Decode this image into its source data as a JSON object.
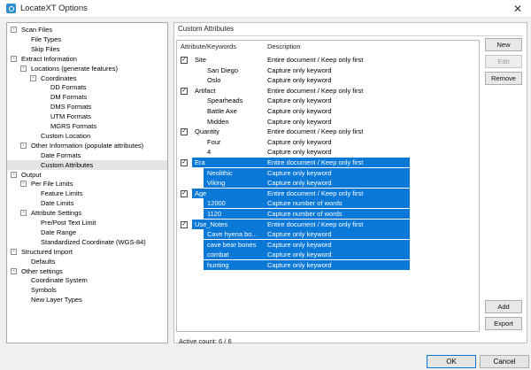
{
  "window": {
    "title": "LocateXT Options",
    "close_glyph": "✕"
  },
  "tree": {
    "items": [
      {
        "label": "Scan Files",
        "level": 0,
        "expander": "-"
      },
      {
        "label": "File Types",
        "level": 1,
        "expander": ""
      },
      {
        "label": "Skip Files",
        "level": 1,
        "expander": ""
      },
      {
        "label": "Extract Information",
        "level": 0,
        "expander": "-"
      },
      {
        "label": "Locations (generate features)",
        "level": 1,
        "expander": "-"
      },
      {
        "label": "Coordinates",
        "level": 2,
        "expander": "-"
      },
      {
        "label": "DD Formats",
        "level": 3,
        "expander": ""
      },
      {
        "label": "DM Formats",
        "level": 3,
        "expander": ""
      },
      {
        "label": "DMS Formats",
        "level": 3,
        "expander": ""
      },
      {
        "label": "UTM Formats",
        "level": 3,
        "expander": ""
      },
      {
        "label": "MGRS Formats",
        "level": 3,
        "expander": ""
      },
      {
        "label": "Custom Location",
        "level": 2,
        "expander": ""
      },
      {
        "label": "Other Information (populate attributes)",
        "level": 1,
        "expander": "-"
      },
      {
        "label": "Date Formats",
        "level": 2,
        "expander": ""
      },
      {
        "label": "Custom Attributes",
        "level": 2,
        "expander": "",
        "selected": true
      },
      {
        "label": "Output",
        "level": 0,
        "expander": "-"
      },
      {
        "label": "Per File Limits",
        "level": 1,
        "expander": "-"
      },
      {
        "label": "Feature Limits",
        "level": 2,
        "expander": ""
      },
      {
        "label": "Date Limits",
        "level": 2,
        "expander": ""
      },
      {
        "label": "Attribute Settings",
        "level": 1,
        "expander": "-"
      },
      {
        "label": "Pre/Post Text Limit",
        "level": 2,
        "expander": ""
      },
      {
        "label": "Date Range",
        "level": 2,
        "expander": ""
      },
      {
        "label": "Standardized Coordinate (WGS-84)",
        "level": 2,
        "expander": ""
      },
      {
        "label": "Structured Import",
        "level": 0,
        "expander": "-"
      },
      {
        "label": "Defaults",
        "level": 1,
        "expander": ""
      },
      {
        "label": "Other settings",
        "level": 0,
        "expander": "-"
      },
      {
        "label": "Coordinate System",
        "level": 1,
        "expander": ""
      },
      {
        "label": "Symbols",
        "level": 1,
        "expander": ""
      },
      {
        "label": "New Layer Types",
        "level": 1,
        "expander": ""
      }
    ]
  },
  "panel": {
    "title": "Custom Attributes",
    "columns": {
      "keywords": "Attribute/Keywords",
      "description": "Description"
    },
    "rows": [
      {
        "kw": "Site",
        "desc": "Entire document / Keep only first",
        "parent": true,
        "checked": true,
        "selected": false
      },
      {
        "kw": "San Diego",
        "desc": "Capture only keyword",
        "parent": false,
        "selected": false
      },
      {
        "kw": "Oslo",
        "desc": "Capture only keyword",
        "parent": false,
        "selected": false
      },
      {
        "kw": "Artifact",
        "desc": "Entire document / Keep only first",
        "parent": true,
        "checked": true,
        "selected": false
      },
      {
        "kw": "Spearheads",
        "desc": "Capture only keyword",
        "parent": false,
        "selected": false
      },
      {
        "kw": "Battle Axe",
        "desc": "Capture only keyword",
        "parent": false,
        "selected": false
      },
      {
        "kw": "Midden",
        "desc": "Capture only keyword",
        "parent": false,
        "selected": false
      },
      {
        "kw": "Quantity",
        "desc": "Entire document / Keep only first",
        "parent": true,
        "checked": true,
        "selected": false
      },
      {
        "kw": "Four",
        "desc": "Capture only keyword",
        "parent": false,
        "selected": false
      },
      {
        "kw": "4",
        "desc": "Capture only keyword",
        "parent": false,
        "selected": false
      },
      {
        "kw": "Era",
        "desc": "Entire document / Keep only first",
        "parent": true,
        "checked": true,
        "selected": true
      },
      {
        "kw": "Neolithic",
        "desc": "Capture only keyword",
        "parent": false,
        "selected": true
      },
      {
        "kw": "Viking",
        "desc": "Capture only keyword",
        "parent": false,
        "selected": true
      },
      {
        "kw": "Age",
        "desc": "Entire document / Keep only first",
        "parent": true,
        "checked": true,
        "selected": true
      },
      {
        "kw": "12000",
        "desc": "Capture number of words",
        "parent": false,
        "selected": true
      },
      {
        "kw": "1120",
        "desc": "Capture number of words",
        "parent": false,
        "selected": true
      },
      {
        "kw": "Use_Notes",
        "desc": "Entire document / Keep only first",
        "parent": true,
        "checked": true,
        "selected": true
      },
      {
        "kw": "Cave hyena bo...",
        "desc": "Capture only keyword",
        "parent": false,
        "selected": true
      },
      {
        "kw": "cave bear bones",
        "desc": "Capture only keyword",
        "parent": false,
        "selected": true
      },
      {
        "kw": "combat",
        "desc": "Capture only keyword",
        "parent": false,
        "selected": true
      },
      {
        "kw": "hunting",
        "desc": "Capture only keyword",
        "parent": false,
        "selected": true
      }
    ],
    "buttons": {
      "new": "New",
      "edit": "Edit",
      "remove": "Remove",
      "add": "Add",
      "export": "Export"
    },
    "active_count": "Active count: 6 / 6"
  },
  "footer": {
    "ok": "OK",
    "cancel": "Cancel"
  },
  "colors": {
    "selection": "#0a78d7",
    "tree_selected": "#e4e4e4"
  }
}
